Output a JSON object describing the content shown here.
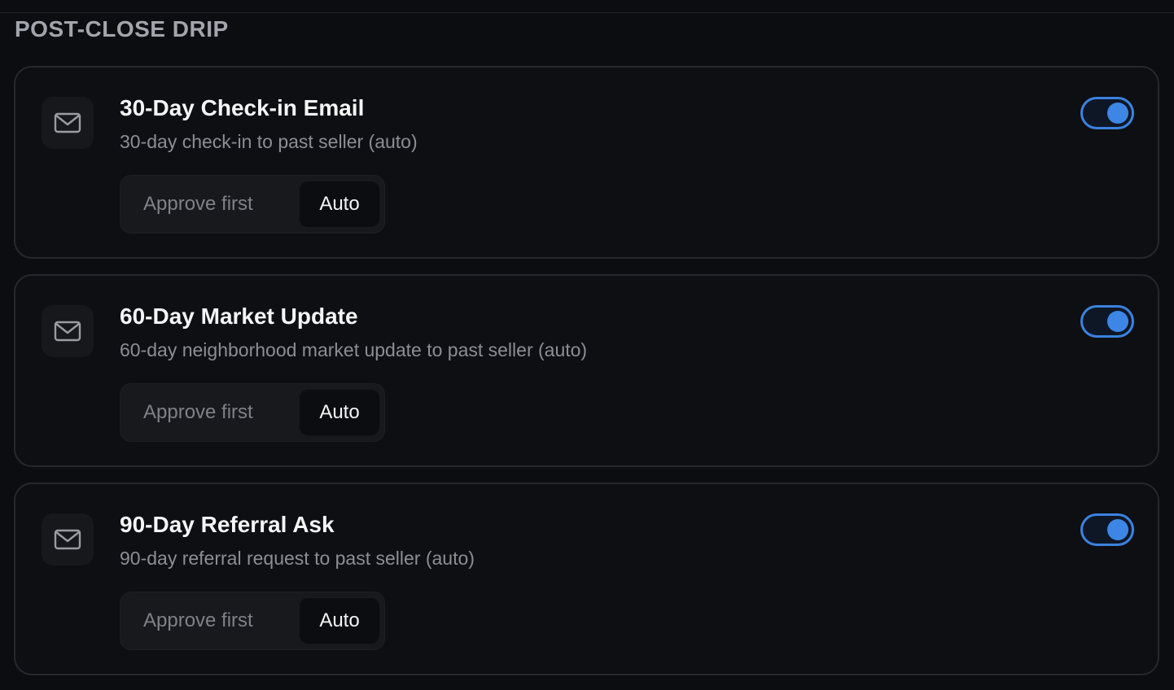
{
  "section": {
    "title": "POST-CLOSE DRIP"
  },
  "accent_color": "#3b82e0",
  "cards": [
    {
      "icon": "mail-icon",
      "title": "30-Day Check-in Email",
      "subtitle": "30-day check-in to past seller (auto)",
      "mode_options": [
        "Approve first",
        "Auto"
      ],
      "selected_mode": "Auto",
      "enabled": true
    },
    {
      "icon": "mail-icon",
      "title": "60-Day Market Update",
      "subtitle": "60-day neighborhood market update to past seller (auto)",
      "mode_options": [
        "Approve first",
        "Auto"
      ],
      "selected_mode": "Auto",
      "enabled": true
    },
    {
      "icon": "mail-icon",
      "title": "90-Day Referral Ask",
      "subtitle": "90-day referral request to past seller (auto)",
      "mode_options": [
        "Approve first",
        "Auto"
      ],
      "selected_mode": "Auto",
      "enabled": true
    }
  ]
}
